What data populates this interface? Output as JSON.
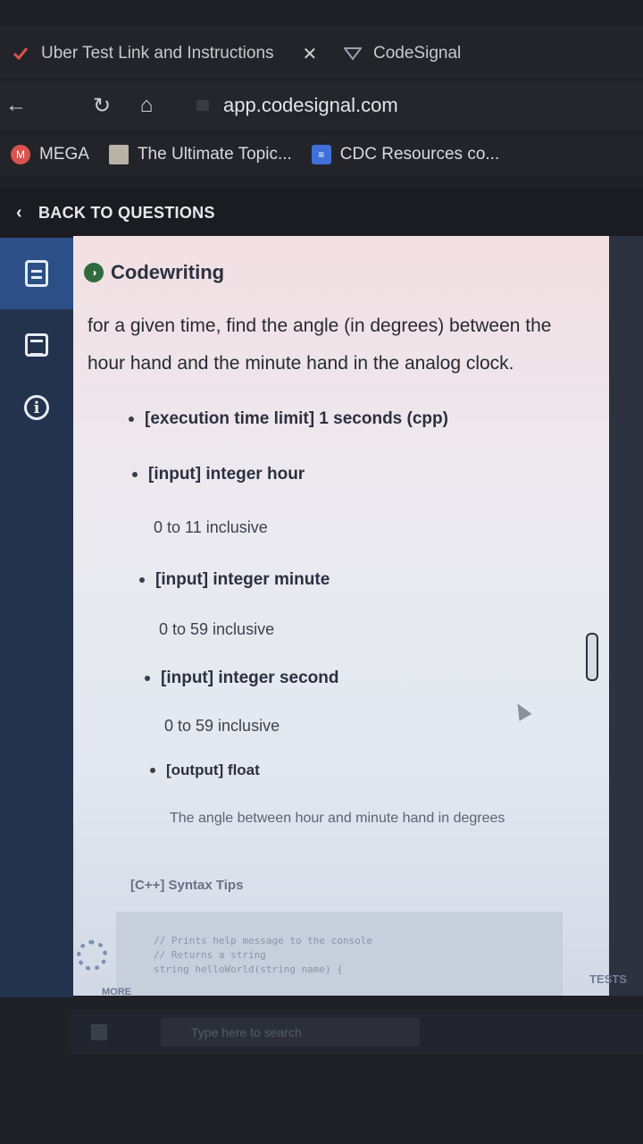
{
  "browser": {
    "tabs": [
      {
        "label": "Uber Test Link and Instructions",
        "close_icon": "close-icon"
      },
      {
        "label": "CodeSignal"
      }
    ],
    "url": "app.codesignal.com",
    "bookmarks": [
      {
        "label": "MEGA",
        "icon_letter": "M"
      },
      {
        "label": "The Ultimate Topic..."
      },
      {
        "label": "CDC Resources co..."
      }
    ]
  },
  "app": {
    "back_label": "BACK TO QUESTIONS",
    "section_title": "Codewriting",
    "description": "for a given time, find the angle (in degrees) between the hour hand and the minute hand in the analog clock.",
    "specs": [
      {
        "label": "[execution time limit] 1 seconds (cpp)"
      },
      {
        "label": "[input] integer hour",
        "detail": "0 to 11 inclusive"
      },
      {
        "label": "[input] integer minute",
        "detail": "0 to 59 inclusive"
      },
      {
        "label": "[input] integer second",
        "detail": "0 to 59 inclusive"
      },
      {
        "label": "[output] float",
        "detail": "The angle between hour and minute hand in degrees"
      }
    ],
    "syntax_tips": "[C++] Syntax Tips",
    "code_lines": [
      "// Prints help message to the console",
      "// Returns a string",
      "string helloWorld(string name) {"
    ],
    "more_label": "MORE",
    "tests_label": "TESTS"
  },
  "taskbar": {
    "search_placeholder": "Type here to search"
  },
  "colors": {
    "rail": "#24334d",
    "rail_active": "#2b4f86",
    "codewriting_icon": "#2f6b3d"
  }
}
